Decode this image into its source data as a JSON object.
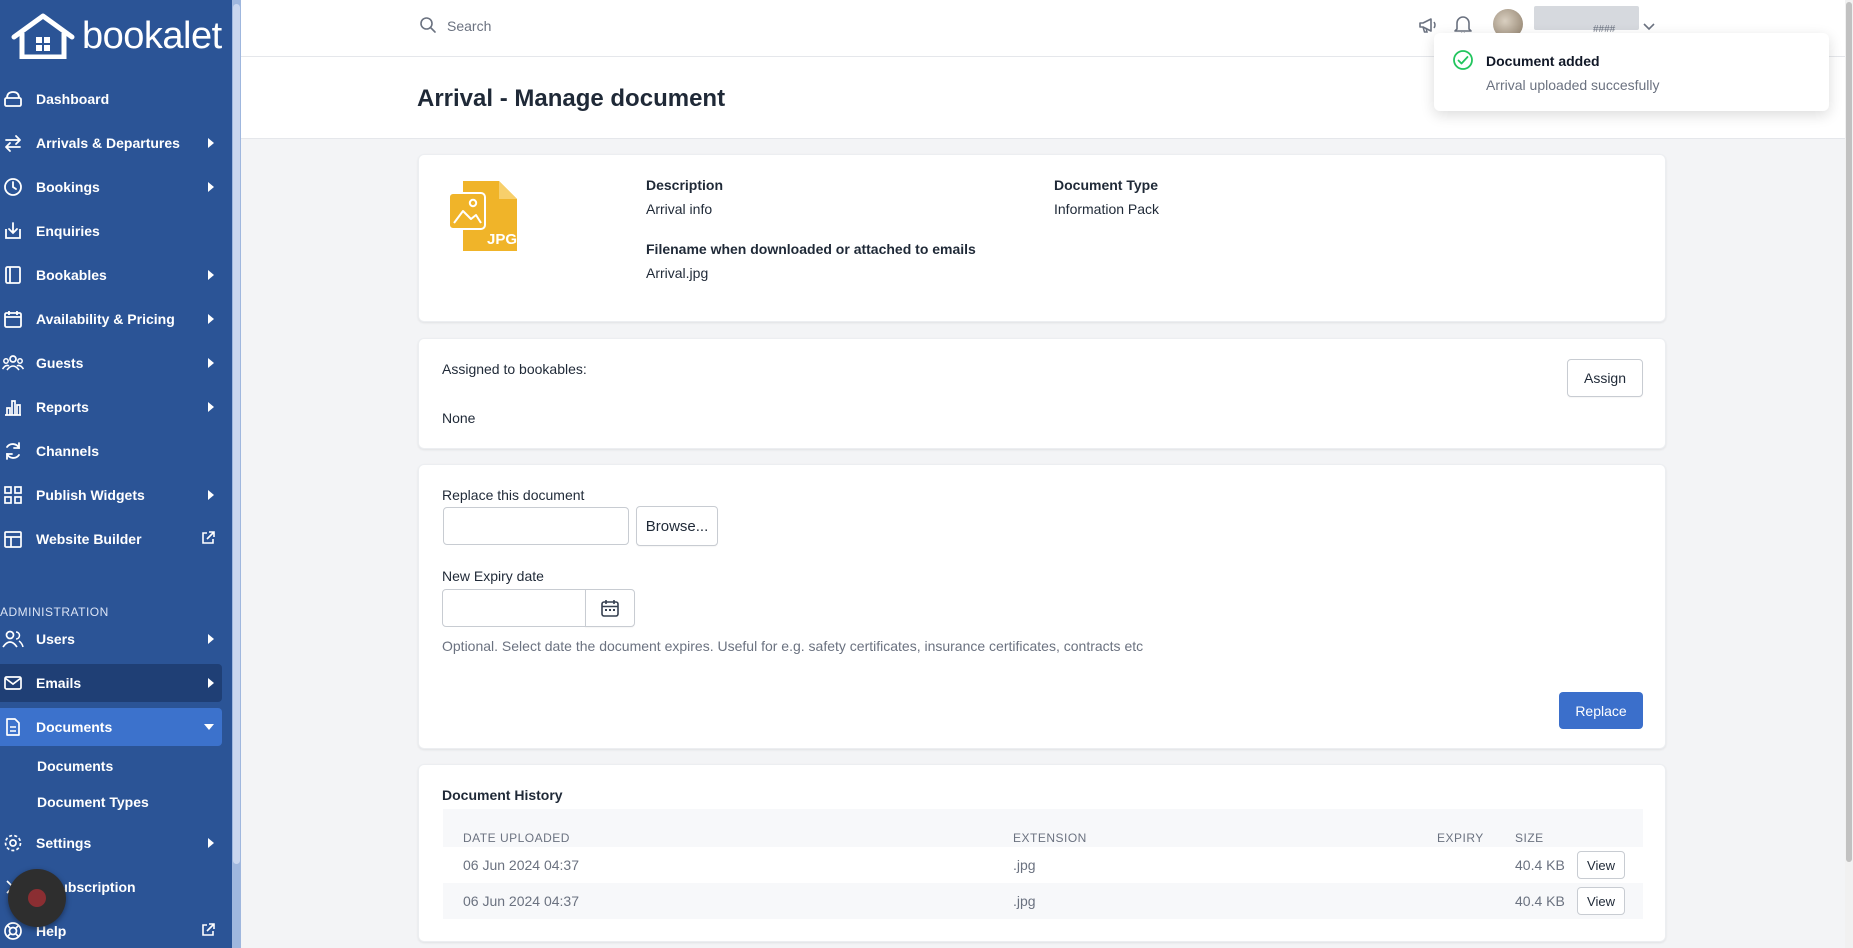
{
  "brand": {
    "logo_text": "bookalet"
  },
  "sidebar": {
    "items": [
      {
        "label": "Dashboard"
      },
      {
        "label": "Arrivals & Departures"
      },
      {
        "label": "Bookings"
      },
      {
        "label": "Enquiries"
      },
      {
        "label": "Bookables"
      },
      {
        "label": "Availability & Pricing"
      },
      {
        "label": "Guests"
      },
      {
        "label": "Reports"
      },
      {
        "label": "Channels"
      },
      {
        "label": "Publish Widgets"
      },
      {
        "label": "Website Builder"
      }
    ],
    "admin_label": "ADMINISTRATION",
    "admin_items": [
      {
        "label": "Users"
      },
      {
        "label": "Emails"
      },
      {
        "label": "Documents"
      },
      {
        "label": "Settings"
      },
      {
        "label": "Subscription"
      },
      {
        "label": "Help"
      }
    ],
    "documents_sub": [
      {
        "label": "Documents"
      },
      {
        "label": "Document Types"
      }
    ]
  },
  "header": {
    "search_placeholder": "Search",
    "user_sub": "####"
  },
  "page": {
    "title": "Arrival - Manage document"
  },
  "details": {
    "file_badge": "JPG",
    "description_label": "Description",
    "description_value": "Arrival info",
    "doctype_label": "Document Type",
    "doctype_value": "Information Pack",
    "filename_label": "Filename when downloaded or attached to emails",
    "filename_value": "Arrival.jpg"
  },
  "assigned": {
    "label": "Assigned to bookables:",
    "value": "None",
    "assign_button": "Assign"
  },
  "replace": {
    "label": "Replace this document",
    "browse_button": "Browse...",
    "expiry_label": "New Expiry date",
    "hint": "Optional. Select date the document expires. Useful for e.g. safety certificates, insurance certificates, contracts etc",
    "replace_button": "Replace"
  },
  "history": {
    "title": "Document History",
    "columns": [
      "DATE UPLOADED",
      "EXTENSION",
      "EXPIRY",
      "SIZE"
    ],
    "rows": [
      {
        "date": "06 Jun 2024 04:37",
        "extension": ".jpg",
        "expiry": "",
        "size": "40.4 KB",
        "action": "View"
      },
      {
        "date": "06 Jun 2024 04:37",
        "extension": ".jpg",
        "expiry": "",
        "size": "40.4 KB",
        "action": "View"
      }
    ]
  },
  "toast": {
    "title": "Document added",
    "message": "Arrival uploaded succesfully"
  },
  "colors": {
    "sidebar": "#2b5496",
    "active": "#3c72cc",
    "primary": "#3b6fcb",
    "file_icon": "#f0b429",
    "success": "#22c55e"
  }
}
